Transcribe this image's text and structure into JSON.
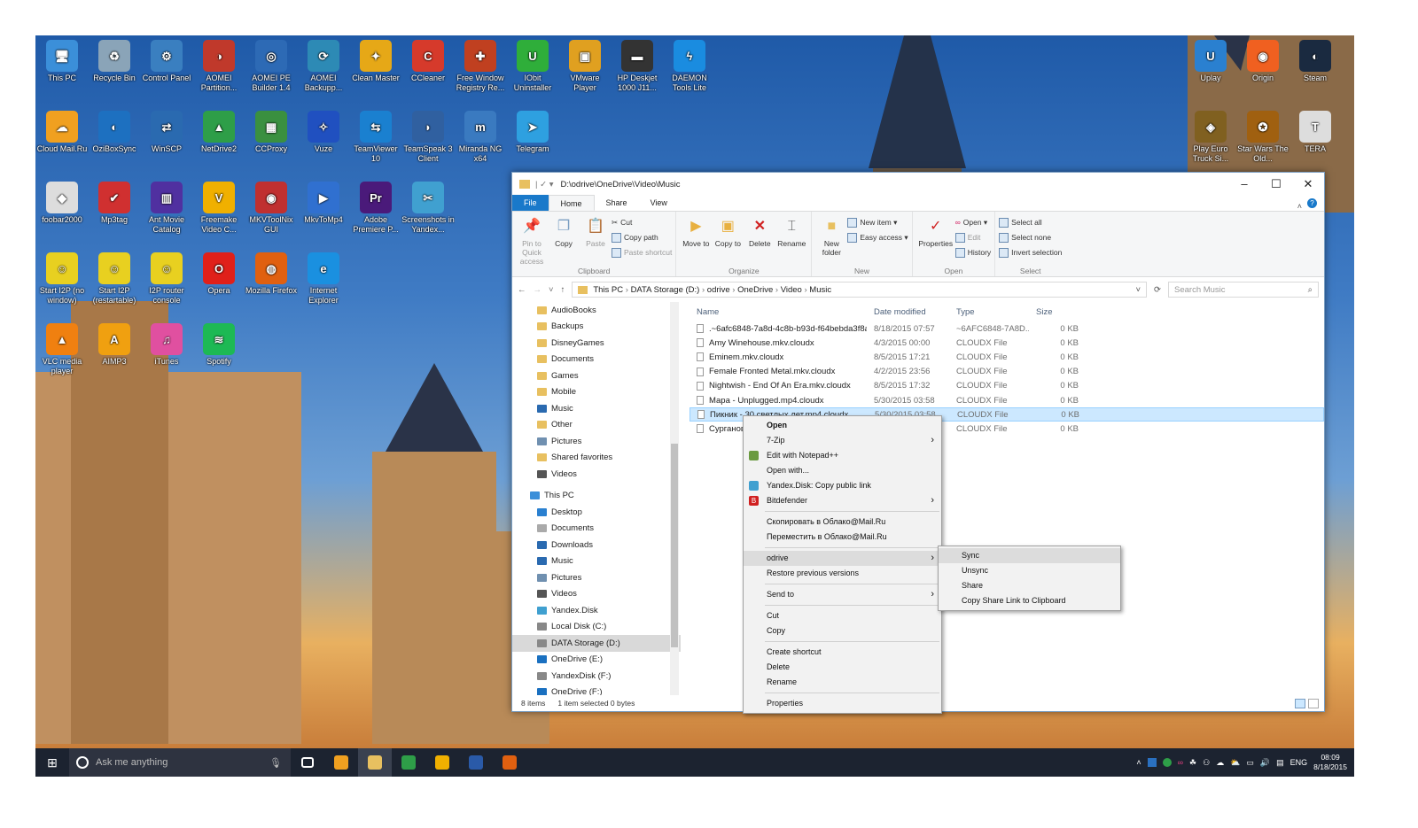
{
  "desktop": {
    "icons": [
      {
        "label": "This PC",
        "color": "#3b8fd9",
        "glyph": "🖥"
      },
      {
        "label": "Recycle Bin",
        "color": "#8aa4b8",
        "glyph": "♻"
      },
      {
        "label": "Control Panel",
        "color": "#3a7fc0",
        "glyph": "⚙"
      },
      {
        "label": "AOMEI Partition...",
        "color": "#c0392b",
        "glyph": "◑"
      },
      {
        "label": "AOMEI PE Builder 1.4",
        "color": "#2d6ab5",
        "glyph": "◎"
      },
      {
        "label": "AOMEI Backupp...",
        "color": "#2d8ab5",
        "glyph": "⟳"
      },
      {
        "label": "Clean Master",
        "color": "#e6a817",
        "glyph": "✦"
      },
      {
        "label": "CCleaner",
        "color": "#d63a2b",
        "glyph": "C"
      },
      {
        "label": "Free Window Registry Re...",
        "color": "#c04020",
        "glyph": "✚"
      },
      {
        "label": "IObit Uninstaller",
        "color": "#2fae3a",
        "glyph": "U"
      },
      {
        "label": "VMware Player",
        "color": "#e0a020",
        "glyph": "▣"
      },
      {
        "label": "HP Deskjet 1000 J11...",
        "color": "#333333",
        "glyph": "▬"
      },
      {
        "label": "DAEMON Tools Lite",
        "color": "#1a8ce0",
        "glyph": "ϟ"
      },
      {
        "label": "Cloud Mail.Ru",
        "color": "#f0a020",
        "glyph": "☁"
      },
      {
        "label": "OziBoxSync",
        "color": "#1d70c0",
        "glyph": "◐"
      },
      {
        "label": "WinSCP",
        "color": "#2a6ab0",
        "glyph": "⇄"
      },
      {
        "label": "NetDrive2",
        "color": "#2e9e48",
        "glyph": "▲"
      },
      {
        "label": "CCProxy",
        "color": "#3a9040",
        "glyph": "▦"
      },
      {
        "label": "Vuze",
        "color": "#2050c0",
        "glyph": "✧"
      },
      {
        "label": "TeamViewer 10",
        "color": "#1a80d0",
        "glyph": "⇆"
      },
      {
        "label": "TeamSpeak 3 Client",
        "color": "#3060a0",
        "glyph": "◗"
      },
      {
        "label": "Miranda NG x64",
        "color": "#3a7ac0",
        "glyph": "m"
      },
      {
        "label": "Telegram",
        "color": "#2ea0e0",
        "glyph": "➤"
      },
      {
        "label": "foobar2000",
        "color": "#dddddd",
        "glyph": "◆"
      },
      {
        "label": "Mp3tag",
        "color": "#d03030",
        "glyph": "✔"
      },
      {
        "label": "Ant Movie Catalog",
        "color": "#5030a0",
        "glyph": "▥"
      },
      {
        "label": "Freemake Video C...",
        "color": "#f0b000",
        "glyph": "V"
      },
      {
        "label": "MKVToolNix GUI",
        "color": "#c03030",
        "glyph": "◉"
      },
      {
        "label": "MkvToMp4",
        "color": "#3070d0",
        "glyph": "▶"
      },
      {
        "label": "Adobe Premiere P...",
        "color": "#4a1a7a",
        "glyph": "Pr"
      },
      {
        "label": "Screenshots in Yandex...",
        "color": "#40a0d0",
        "glyph": "✂"
      },
      {
        "label": "Start I2P (no window)",
        "color": "#e8d020",
        "glyph": "☺"
      },
      {
        "label": "Start I2P (restartable)",
        "color": "#e8d020",
        "glyph": "☺"
      },
      {
        "label": "I2P router console",
        "color": "#e8d020",
        "glyph": "☺"
      },
      {
        "label": "Opera",
        "color": "#e0201a",
        "glyph": "O"
      },
      {
        "label": "Mozilla Firefox",
        "color": "#e06010",
        "glyph": "◍"
      },
      {
        "label": "Internet Explorer",
        "color": "#1a90e0",
        "glyph": "e"
      },
      {
        "label": "VLC media player",
        "color": "#f08010",
        "glyph": "▲"
      },
      {
        "label": "AIMP3",
        "color": "#f0a010",
        "glyph": "A"
      },
      {
        "label": "iTunes",
        "color": "#e050a0",
        "glyph": "♫"
      },
      {
        "label": "Spotify",
        "color": "#1db954",
        "glyph": "≋"
      }
    ],
    "right_icons": [
      {
        "label": "Uplay",
        "color": "#2a80d0",
        "glyph": "U"
      },
      {
        "label": "Origin",
        "color": "#f06020",
        "glyph": "◉"
      },
      {
        "label": "Steam",
        "color": "#1a2a40",
        "glyph": "◐"
      },
      {
        "label": "Play Euro Truck Si...",
        "color": "#806020",
        "glyph": "◈"
      },
      {
        "label": "Star Wars The Old...",
        "color": "#a06010",
        "glyph": "✪"
      },
      {
        "label": "TERA",
        "color": "#dddddd",
        "glyph": "T"
      }
    ]
  },
  "explorer": {
    "title": "D:\\odrive\\OneDrive\\Video\\Music",
    "tabs": [
      "File",
      "Home",
      "Share",
      "View"
    ],
    "ribbon": {
      "clipboard": {
        "pin": "Pin to Quick access",
        "copy": "Copy",
        "paste": "Paste",
        "cut": "Cut",
        "copy_path": "Copy path",
        "paste_shortcut": "Paste shortcut",
        "label": "Clipboard"
      },
      "organize": {
        "move": "Move to",
        "copy": "Copy to",
        "delete": "Delete",
        "rename": "Rename",
        "label": "Organize"
      },
      "new": {
        "new_folder": "New folder",
        "new_item": "New item",
        "easy_access": "Easy access",
        "label": "New"
      },
      "open": {
        "properties": "Properties",
        "open": "Open",
        "edit": "Edit",
        "history": "History",
        "label": "Open"
      },
      "select": {
        "all": "Select all",
        "none": "Select none",
        "invert": "Invert selection",
        "label": "Select"
      }
    },
    "breadcrumb": [
      "This PC",
      "DATA Storage (D:)",
      "odrive",
      "OneDrive",
      "Video",
      "Music"
    ],
    "search_placeholder": "Search Music",
    "nav": [
      {
        "label": "AudioBooks",
        "color": "#e8c060",
        "lvl": 1
      },
      {
        "label": "Backups",
        "color": "#e8c060",
        "lvl": 1
      },
      {
        "label": "DisneyGames",
        "color": "#e8c060",
        "lvl": 1
      },
      {
        "label": "Documents",
        "color": "#e8c060",
        "lvl": 1
      },
      {
        "label": "Games",
        "color": "#e8c060",
        "lvl": 1
      },
      {
        "label": "Mobile",
        "color": "#e8c060",
        "lvl": 1
      },
      {
        "label": "Music",
        "color": "#2a6ab0",
        "lvl": 1
      },
      {
        "label": "Other",
        "color": "#e8c060",
        "lvl": 1
      },
      {
        "label": "Pictures",
        "color": "#7090b0",
        "lvl": 1
      },
      {
        "label": "Shared favorites",
        "color": "#e8c060",
        "lvl": 1
      },
      {
        "label": "Videos",
        "color": "#555555",
        "lvl": 1
      },
      {
        "label": "This PC",
        "color": "#3b8fd9",
        "lvl": 0
      },
      {
        "label": "Desktop",
        "color": "#2a80d0",
        "lvl": 1
      },
      {
        "label": "Documents",
        "color": "#aaaaaa",
        "lvl": 1
      },
      {
        "label": "Downloads",
        "color": "#2a6ab0",
        "lvl": 1
      },
      {
        "label": "Music",
        "color": "#2a6ab0",
        "lvl": 1
      },
      {
        "label": "Pictures",
        "color": "#7090b0",
        "lvl": 1
      },
      {
        "label": "Videos",
        "color": "#555555",
        "lvl": 1
      },
      {
        "label": "Yandex.Disk",
        "color": "#40a0d0",
        "lvl": 1
      },
      {
        "label": "Local Disk (C:)",
        "color": "#888888",
        "lvl": 1
      },
      {
        "label": "DATA Storage (D:)",
        "color": "#888888",
        "lvl": 1,
        "selected": true
      },
      {
        "label": "OneDrive (E:)",
        "color": "#1a70c0",
        "lvl": 1
      },
      {
        "label": "YandexDisk (F:)",
        "color": "#888888",
        "lvl": 1
      },
      {
        "label": "OneDrive (F:)",
        "color": "#1a70c0",
        "lvl": 1
      }
    ],
    "columns": [
      "Name",
      "Date modified",
      "Type",
      "Size"
    ],
    "files": [
      {
        "name": ".~6afc6848-7a8d-4c8b-b93d-f64bebda3f8a",
        "date": "8/18/2015 07:57",
        "type": "~6AFC6848-7A8D...",
        "size": "0 KB"
      },
      {
        "name": "Amy Winehouse.mkv.cloudx",
        "date": "4/3/2015 00:00",
        "type": "CLOUDX File",
        "size": "0 KB"
      },
      {
        "name": "Eminem.mkv.cloudx",
        "date": "8/5/2015 17:21",
        "type": "CLOUDX File",
        "size": "0 KB"
      },
      {
        "name": "Female Fronted Metal.mkv.cloudx",
        "date": "4/2/2015 23:56",
        "type": "CLOUDX File",
        "size": "0 KB"
      },
      {
        "name": "Nightwish - End Of An Era.mkv.cloudx",
        "date": "8/5/2015 17:32",
        "type": "CLOUDX File",
        "size": "0 KB"
      },
      {
        "name": "Мара - Unplugged.mp4.cloudx",
        "date": "5/30/2015 03:58",
        "type": "CLOUDX File",
        "size": "0 KB"
      },
      {
        "name": "Пикник - 30 светлых лет.mp4.cloudx",
        "date": "5/30/2015 03:58",
        "type": "CLOUDX File",
        "size": "0 KB",
        "selected": true
      },
      {
        "name": "Сурганова и Оркестр.mp4.cloudx",
        "date": "",
        "type": "CLOUDX File",
        "size": "0 KB"
      }
    ],
    "status": {
      "count": "8 items",
      "selection": "1 item selected  0 bytes"
    }
  },
  "context_menu": {
    "items": [
      {
        "label": "Open",
        "bold": true
      },
      {
        "label": "7-Zip",
        "sub": true
      },
      {
        "label": "Edit with Notepad++",
        "icon": "#6a9a40"
      },
      {
        "label": "Open with..."
      },
      {
        "label": "Yandex.Disk: Copy public link",
        "icon": "#40a0d0"
      },
      {
        "label": "Bitdefender",
        "sub": true,
        "icon": "#d02020",
        "glyph": "B"
      },
      {
        "sep": true
      },
      {
        "label": "Скопировать в Облако@Mail.Ru"
      },
      {
        "label": "Переместить в Облако@Mail.Ru"
      },
      {
        "sep": true
      },
      {
        "label": "odrive",
        "sub": true,
        "highlight": true
      },
      {
        "label": "Restore previous versions"
      },
      {
        "sep": true
      },
      {
        "label": "Send to",
        "sub": true
      },
      {
        "sep": true
      },
      {
        "label": "Cut"
      },
      {
        "label": "Copy"
      },
      {
        "sep": true
      },
      {
        "label": "Create shortcut"
      },
      {
        "label": "Delete"
      },
      {
        "label": "Rename"
      },
      {
        "sep": true
      },
      {
        "label": "Properties"
      }
    ],
    "odrive_sub": [
      "Sync",
      "Unsync",
      "Share",
      "Copy Share Link to Clipboard"
    ]
  },
  "taskbar": {
    "search_placeholder": "Ask me anything",
    "apps": [
      {
        "name": "task-view",
        "color": "#1c2330"
      },
      {
        "name": "store",
        "color": "#f0a020"
      },
      {
        "name": "file-explorer",
        "color": "#e8c060"
      },
      {
        "name": "chrome",
        "color": "#2e9e48"
      },
      {
        "name": "freemake",
        "color": "#f0b000"
      },
      {
        "name": "word",
        "color": "#2a5aa8"
      },
      {
        "name": "firefox",
        "color": "#e06010"
      }
    ],
    "lang": "ENG",
    "time": "08:09",
    "date": "8/18/2015"
  }
}
